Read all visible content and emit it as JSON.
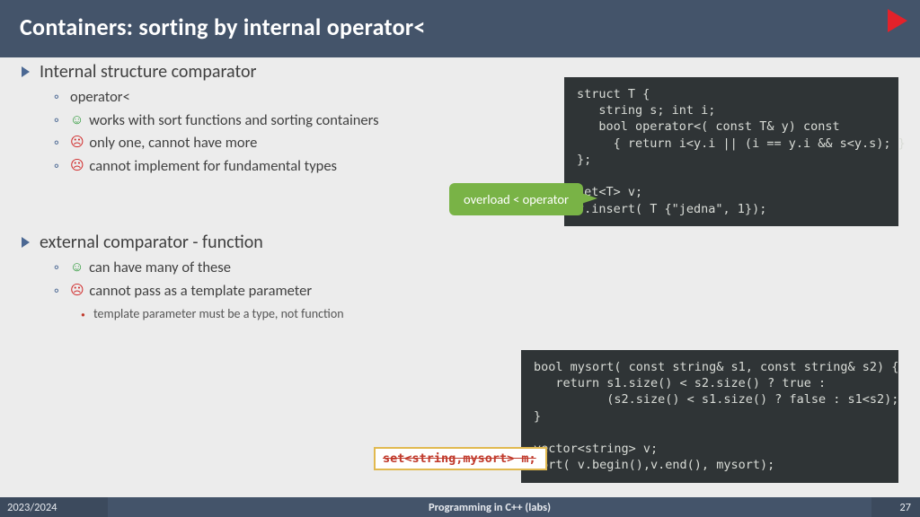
{
  "header": {
    "title": "Containers: sorting by internal operator<"
  },
  "sections": [
    {
      "title": "Internal structure comparator",
      "items": [
        {
          "mood": "none",
          "text": "operator<"
        },
        {
          "mood": "smile",
          "text": "works with sort functions and sorting containers"
        },
        {
          "mood": "sad",
          "text": "only one, cannot have more"
        },
        {
          "mood": "sad",
          "text": "cannot implement for fundamental types"
        }
      ],
      "subitems": []
    },
    {
      "title": "external comparator - function",
      "items": [
        {
          "mood": "smile",
          "text": "can have many of these"
        },
        {
          "mood": "sad",
          "text": "cannot pass as a template parameter"
        }
      ],
      "subitems": [
        {
          "text": "template parameter must be a type, not function"
        }
      ]
    }
  ],
  "callout": "overload < operator",
  "code1": "struct T {\n   string s; int i;\n   bool operator<( const T& y) const\n     { return i<y.i || (i == y.i && s<y.s); }\n};\n\nset<T> v;\nv.insert( T {\"jedna\", 1});",
  "code2": "bool mysort( const string& s1, const string& s2) {\n   return s1.size() < s2.size() ? true :\n          (s2.size() < s1.size() ? false : s1<s2);\n}\n\nvector<string> v;\nsort( v.begin(),v.end(), mysort);",
  "bad_snippet": "set<string,mysort> m;",
  "footer": {
    "year": "2023/2024",
    "course": "Programming in C++ (labs)",
    "page": "27"
  },
  "icons": {
    "smile": "☺",
    "sad": "☹"
  }
}
